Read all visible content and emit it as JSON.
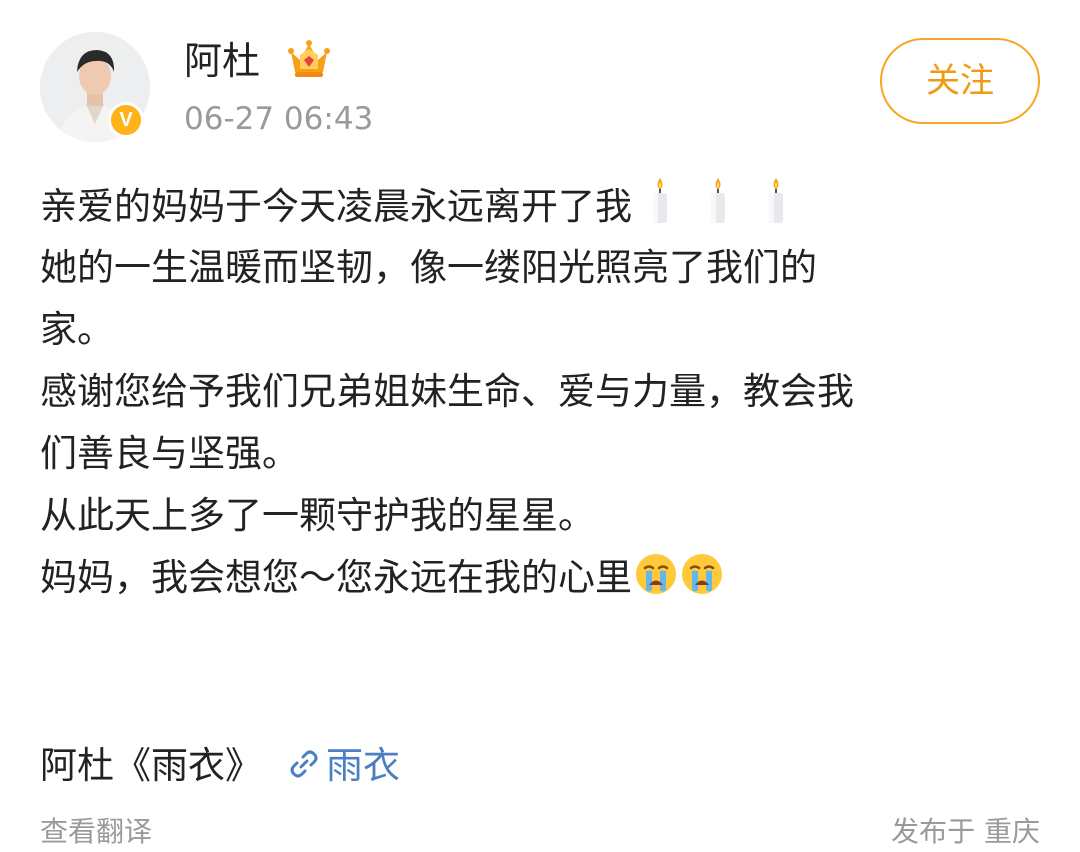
{
  "author": {
    "name": "阿杜",
    "verified_mark": "V",
    "timestamp": "06-27 06:43",
    "badge_icon": "crown-icon"
  },
  "follow_button": {
    "label": "关注"
  },
  "post": {
    "lines": [
      {
        "text": "亲爱的妈妈于今天凌晨永远离开了我",
        "emoji": "candle-icon",
        "emoji_count": 3
      },
      {
        "text": "她的一生温暖而坚韧，像一缕阳光照亮了我们的"
      },
      {
        "text": "家。"
      },
      {
        "text": "感谢您给予我们兄弟姐妹生命、爱与力量，教会我"
      },
      {
        "text": "们善良与坚强。"
      },
      {
        "text": "从此天上多了一颗守护我的星星。"
      },
      {
        "text": "妈妈，我会想您～您永远在我的心里",
        "emoji": "crying-face-icon",
        "emoji_count": 2
      }
    ],
    "music_title": "阿杜《雨衣》",
    "music_link_label": "雨衣"
  },
  "footer": {
    "translate_label": "查看翻译",
    "location_label": "发布于 重庆"
  },
  "colors": {
    "accent": "#f5a623",
    "link": "#4a7fc1",
    "muted": "#9a9a9a",
    "text": "#222222"
  }
}
